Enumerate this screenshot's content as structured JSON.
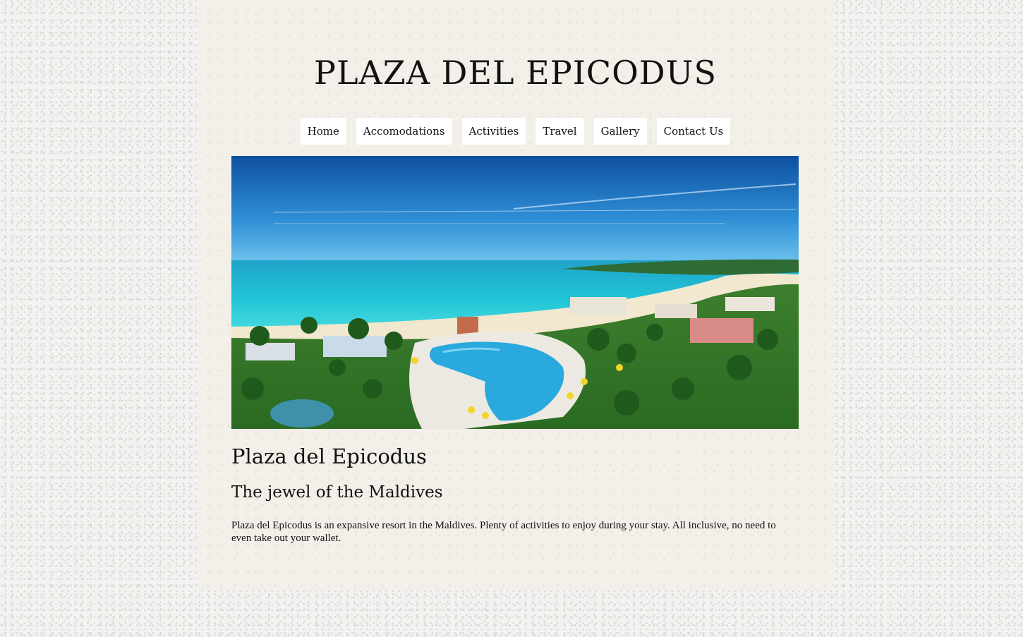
{
  "site": {
    "title": "PLAZA DEL EPICODUS"
  },
  "nav": {
    "items": [
      {
        "label": "Home"
      },
      {
        "label": "Accomodations"
      },
      {
        "label": "Activities"
      },
      {
        "label": "Travel"
      },
      {
        "label": "Gallery"
      },
      {
        "label": "Contact Us"
      }
    ]
  },
  "hero": {
    "alt": "Aerial view of beach resort with pool, palm trees and turquoise sea"
  },
  "content": {
    "heading": "Plaza del Epicodus",
    "subheading": "The jewel of the Maldives",
    "paragraph": "Plaza del Epicodus is an expansive resort in the Maldives. Plenty of activities to enjoy during your stay. All inclusive, no need to even take out your wallet."
  },
  "colors": {
    "page_bg": "#f2f2f0",
    "container_bg": "#f3efe9",
    "nav_bg": "#ffffff",
    "text": "#111111"
  }
}
